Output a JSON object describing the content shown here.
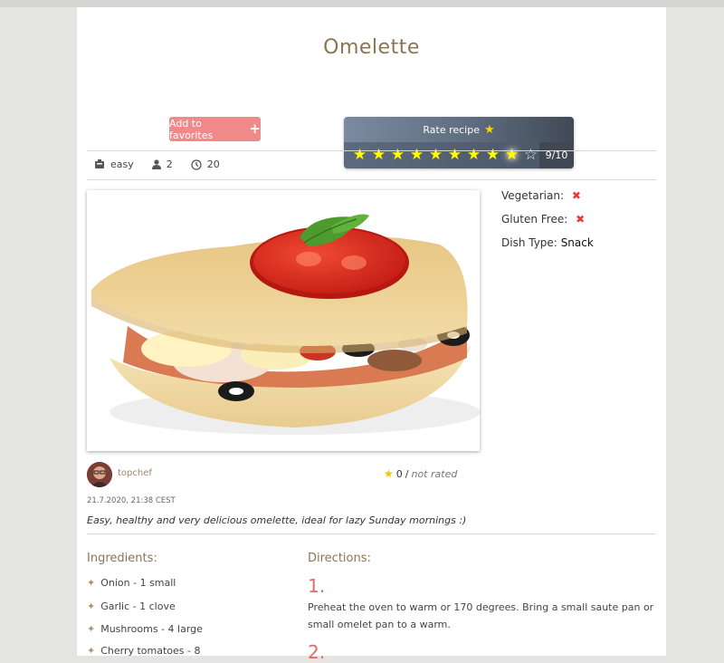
{
  "recipe": {
    "title": "Omelette",
    "favorite_button": "Add to favorites",
    "favorite_plus": "+",
    "rate": {
      "title": "Rate recipe",
      "stars_total": 10,
      "stars_filled": 9,
      "score": "9/10"
    },
    "meta": {
      "difficulty": "easy",
      "servings": "2",
      "time": "20"
    },
    "info": {
      "vegetarian_label": "Vegetarian:",
      "gluten_free_label": "Gluten Free:",
      "dish_type_label": "Dish Type:",
      "dish_type_value": "Snack",
      "no_mark": "✖"
    },
    "author": "topchef",
    "rating_value": "0",
    "rating_sep": "/",
    "rating_note": "not rated",
    "date": "21.7.2020, 21:38 CEST",
    "description": "Easy, healthy and very delicious omelette, ideal for lazy Sunday mornings :)",
    "ingredients_title": "Ingredients:",
    "ingredients": [
      "Onion - 1 small",
      "Garlic - 1 clove",
      "Mushrooms - 4 large",
      "Cherry tomatoes - 8"
    ],
    "directions_title": "Directions:",
    "steps": [
      {
        "num": "1.",
        "text": "Preheat the oven to warm or 170 degrees. Bring a small saute pan or small omelet pan to a warm."
      },
      {
        "num": "2.",
        "text": ""
      }
    ]
  },
  "colors": {
    "title": "#8a7550",
    "favorite": "#f08a8a",
    "star": "#ffff00",
    "cross": "#e23d3d",
    "step_number": "#e06a6a"
  },
  "icons": {
    "bullet": "✦",
    "star": "★",
    "star_empty": "☆"
  }
}
